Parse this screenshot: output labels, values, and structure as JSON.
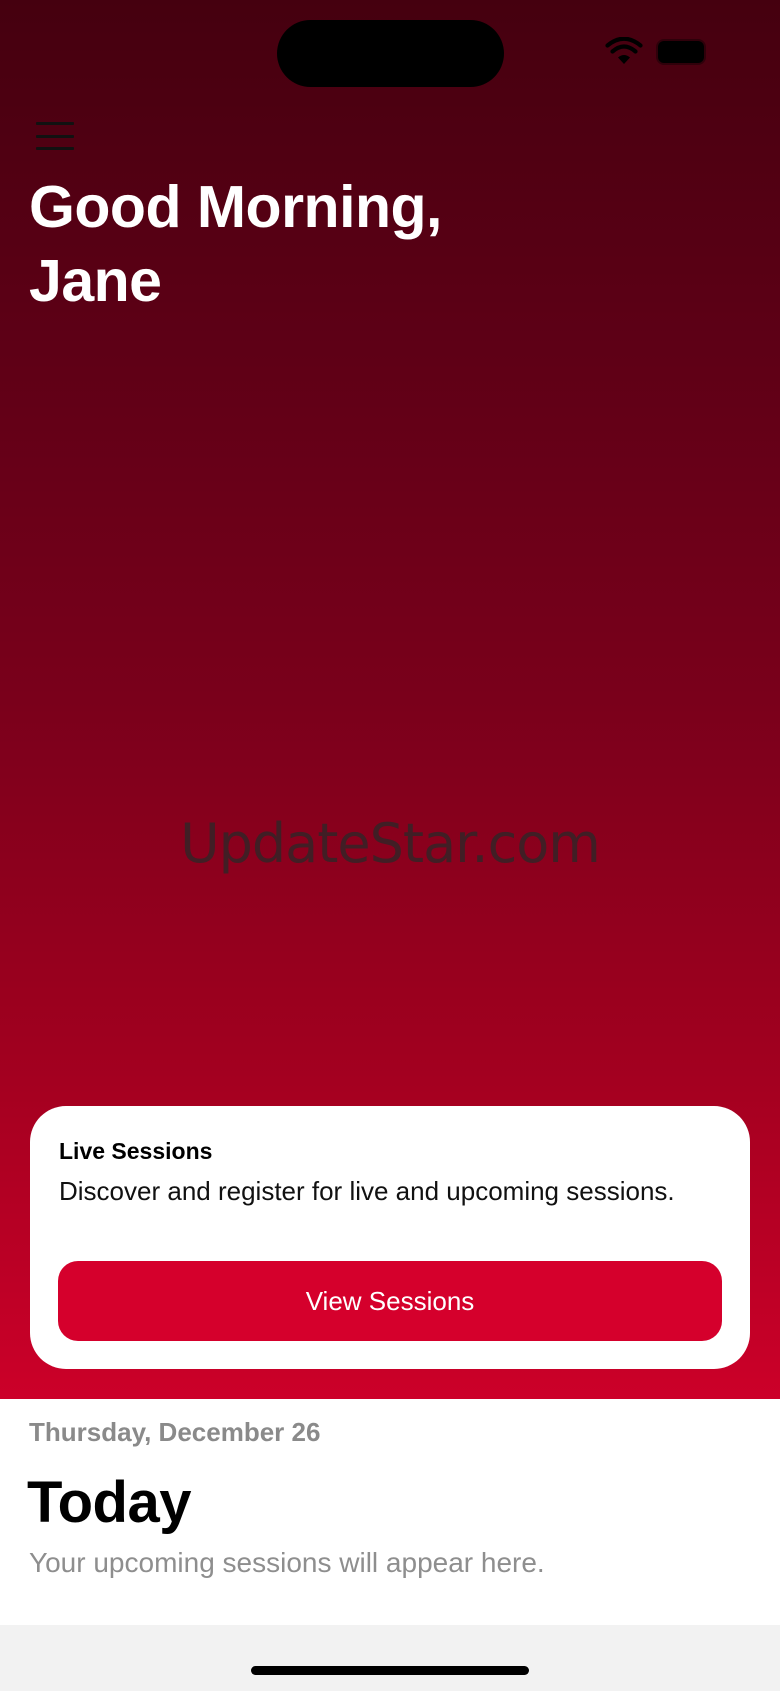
{
  "header": {
    "greeting_line1": "Good Morning,",
    "greeting_line2": "Jane",
    "menu_icon": "hamburger-menu-icon"
  },
  "status_bar": {
    "wifi_icon": "wifi-icon",
    "battery_icon": "battery-icon"
  },
  "watermark": "UpdateStar.com",
  "card": {
    "title": "Live Sessions",
    "description": "Discover and register for live and upcoming sessions.",
    "button_label": "View Sessions"
  },
  "today": {
    "date": "Thursday, December 26",
    "title": "Today",
    "subtitle": "Your upcoming sessions will appear here."
  },
  "colors": {
    "accent": "#d5002c",
    "hero_top": "#45000f",
    "hero_bottom": "#cc0029"
  }
}
